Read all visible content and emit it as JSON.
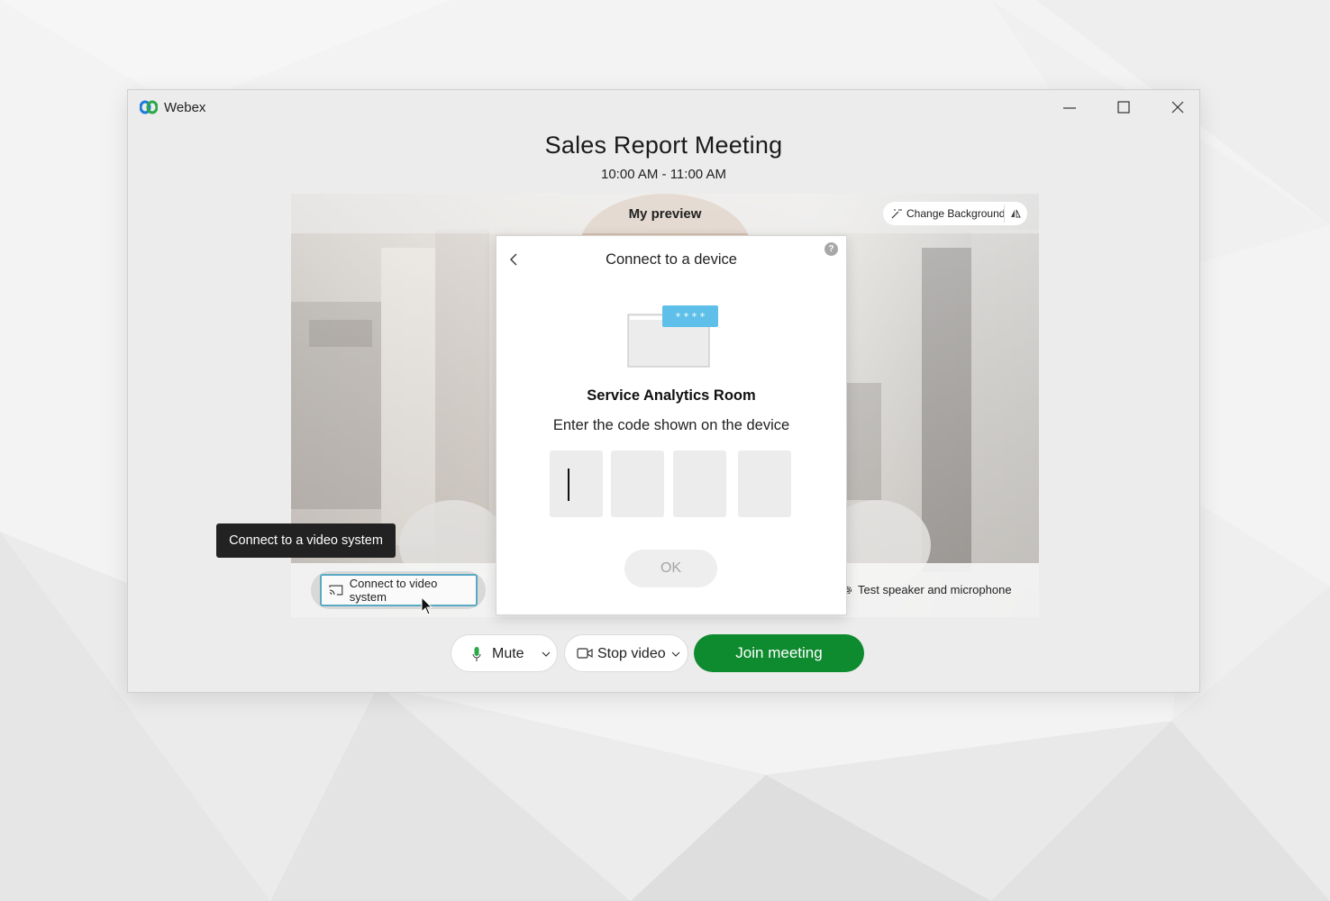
{
  "window": {
    "app_name": "Webex",
    "logo_icon": "webex-logo-icon",
    "controls": [
      "minimize-icon",
      "maximize-icon",
      "close-icon"
    ]
  },
  "meeting": {
    "title": "Sales Report Meeting",
    "time": "10:00 AM - 11:00 AM"
  },
  "preview": {
    "label": "My preview",
    "change_background_label": "Change Background",
    "connect_button_label": "Connect to video system",
    "test_speaker_label": "Test speaker and microphone"
  },
  "tooltip": {
    "text": "Connect to a video system"
  },
  "dialog": {
    "title": "Connect to a device",
    "help_glyph": "?",
    "illustration_code": "* * * *",
    "room_name": "Service Analytics Room",
    "instruction": "Enter the code shown on the device",
    "code_digits": [
      "",
      "",
      "",
      ""
    ],
    "ok_label": "OK"
  },
  "controls": {
    "mute_label": "Mute",
    "stop_video_label": "Stop video",
    "join_label": "Join meeting"
  },
  "colors": {
    "accent_border": "#5aa9c4",
    "join_green": "#0e8a2f",
    "mic_green": "#2aa84a",
    "illustration_blue": "#5ec0e8"
  }
}
